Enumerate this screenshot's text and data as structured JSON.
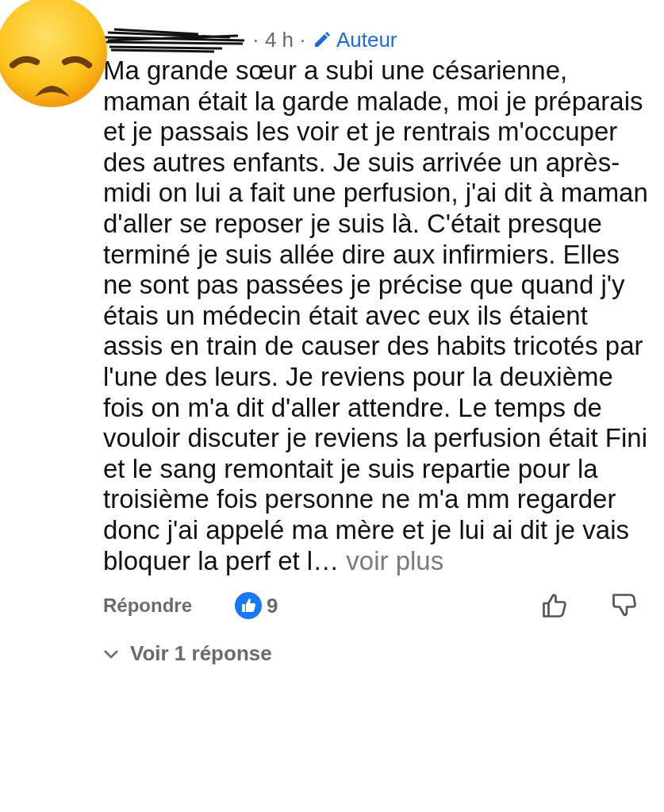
{
  "comment": {
    "time": "4 h",
    "separator": "·",
    "author_badge": "Auteur",
    "body": "Ma grande sœur a subi une césarienne, maman était la garde malade, moi je préparais et je passais les voir et je rentrais m'occuper des autres enfants. Je suis arrivée un après-midi on lui a fait une perfusion, j'ai dit à maman d'aller se reposer je suis là. C'était presque terminé je suis allée dire aux infirmiers. Elles ne sont pas passées je précise que quand j'y étais un médecin était avec eux ils étaient assis en train de causer des habits tricotés par l'une des leurs. Je reviens pour la deuxième fois on m'a dit d'aller attendre. Le temps de vouloir discuter je reviens la perfusion était Fini et le sang remontait  je suis repartie pour la troisième fois personne ne m'a mm regarder donc j'ai appelé ma mère et je lui ai dit je vais bloquer la perf et l…",
    "more_link": "voir plus",
    "reply_button": "Répondre",
    "like_count": "9",
    "view_replies": "Voir 1 réponse"
  }
}
